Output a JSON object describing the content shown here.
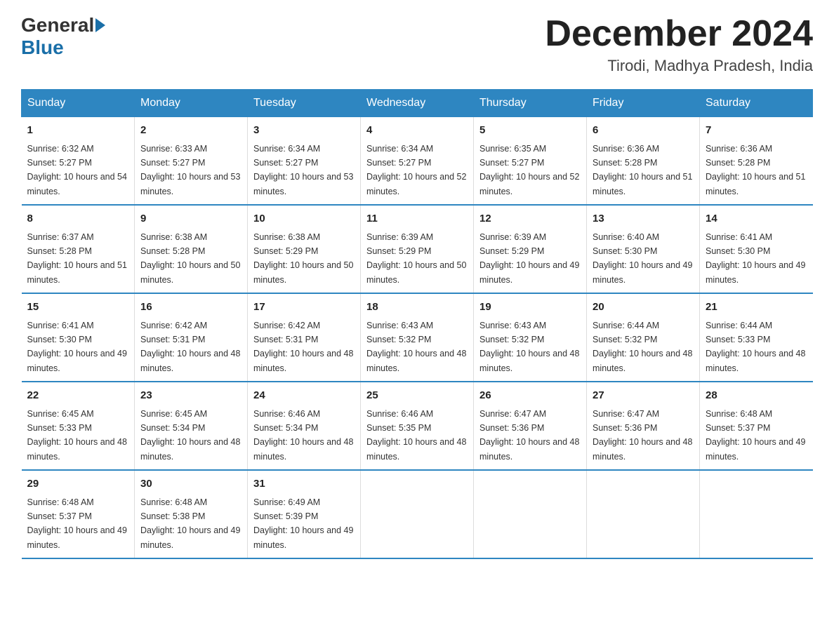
{
  "header": {
    "logo_general": "General",
    "logo_blue": "Blue",
    "month_title": "December 2024",
    "location": "Tirodi, Madhya Pradesh, India"
  },
  "days_of_week": [
    "Sunday",
    "Monday",
    "Tuesday",
    "Wednesday",
    "Thursday",
    "Friday",
    "Saturday"
  ],
  "weeks": [
    [
      {
        "day": "1",
        "sunrise": "6:32 AM",
        "sunset": "5:27 PM",
        "daylight": "10 hours and 54 minutes."
      },
      {
        "day": "2",
        "sunrise": "6:33 AM",
        "sunset": "5:27 PM",
        "daylight": "10 hours and 53 minutes."
      },
      {
        "day": "3",
        "sunrise": "6:34 AM",
        "sunset": "5:27 PM",
        "daylight": "10 hours and 53 minutes."
      },
      {
        "day": "4",
        "sunrise": "6:34 AM",
        "sunset": "5:27 PM",
        "daylight": "10 hours and 52 minutes."
      },
      {
        "day": "5",
        "sunrise": "6:35 AM",
        "sunset": "5:27 PM",
        "daylight": "10 hours and 52 minutes."
      },
      {
        "day": "6",
        "sunrise": "6:36 AM",
        "sunset": "5:28 PM",
        "daylight": "10 hours and 51 minutes."
      },
      {
        "day": "7",
        "sunrise": "6:36 AM",
        "sunset": "5:28 PM",
        "daylight": "10 hours and 51 minutes."
      }
    ],
    [
      {
        "day": "8",
        "sunrise": "6:37 AM",
        "sunset": "5:28 PM",
        "daylight": "10 hours and 51 minutes."
      },
      {
        "day": "9",
        "sunrise": "6:38 AM",
        "sunset": "5:28 PM",
        "daylight": "10 hours and 50 minutes."
      },
      {
        "day": "10",
        "sunrise": "6:38 AM",
        "sunset": "5:29 PM",
        "daylight": "10 hours and 50 minutes."
      },
      {
        "day": "11",
        "sunrise": "6:39 AM",
        "sunset": "5:29 PM",
        "daylight": "10 hours and 50 minutes."
      },
      {
        "day": "12",
        "sunrise": "6:39 AM",
        "sunset": "5:29 PM",
        "daylight": "10 hours and 49 minutes."
      },
      {
        "day": "13",
        "sunrise": "6:40 AM",
        "sunset": "5:30 PM",
        "daylight": "10 hours and 49 minutes."
      },
      {
        "day": "14",
        "sunrise": "6:41 AM",
        "sunset": "5:30 PM",
        "daylight": "10 hours and 49 minutes."
      }
    ],
    [
      {
        "day": "15",
        "sunrise": "6:41 AM",
        "sunset": "5:30 PM",
        "daylight": "10 hours and 49 minutes."
      },
      {
        "day": "16",
        "sunrise": "6:42 AM",
        "sunset": "5:31 PM",
        "daylight": "10 hours and 48 minutes."
      },
      {
        "day": "17",
        "sunrise": "6:42 AM",
        "sunset": "5:31 PM",
        "daylight": "10 hours and 48 minutes."
      },
      {
        "day": "18",
        "sunrise": "6:43 AM",
        "sunset": "5:32 PM",
        "daylight": "10 hours and 48 minutes."
      },
      {
        "day": "19",
        "sunrise": "6:43 AM",
        "sunset": "5:32 PM",
        "daylight": "10 hours and 48 minutes."
      },
      {
        "day": "20",
        "sunrise": "6:44 AM",
        "sunset": "5:32 PM",
        "daylight": "10 hours and 48 minutes."
      },
      {
        "day": "21",
        "sunrise": "6:44 AM",
        "sunset": "5:33 PM",
        "daylight": "10 hours and 48 minutes."
      }
    ],
    [
      {
        "day": "22",
        "sunrise": "6:45 AM",
        "sunset": "5:33 PM",
        "daylight": "10 hours and 48 minutes."
      },
      {
        "day": "23",
        "sunrise": "6:45 AM",
        "sunset": "5:34 PM",
        "daylight": "10 hours and 48 minutes."
      },
      {
        "day": "24",
        "sunrise": "6:46 AM",
        "sunset": "5:34 PM",
        "daylight": "10 hours and 48 minutes."
      },
      {
        "day": "25",
        "sunrise": "6:46 AM",
        "sunset": "5:35 PM",
        "daylight": "10 hours and 48 minutes."
      },
      {
        "day": "26",
        "sunrise": "6:47 AM",
        "sunset": "5:36 PM",
        "daylight": "10 hours and 48 minutes."
      },
      {
        "day": "27",
        "sunrise": "6:47 AM",
        "sunset": "5:36 PM",
        "daylight": "10 hours and 48 minutes."
      },
      {
        "day": "28",
        "sunrise": "6:48 AM",
        "sunset": "5:37 PM",
        "daylight": "10 hours and 49 minutes."
      }
    ],
    [
      {
        "day": "29",
        "sunrise": "6:48 AM",
        "sunset": "5:37 PM",
        "daylight": "10 hours and 49 minutes."
      },
      {
        "day": "30",
        "sunrise": "6:48 AM",
        "sunset": "5:38 PM",
        "daylight": "10 hours and 49 minutes."
      },
      {
        "day": "31",
        "sunrise": "6:49 AM",
        "sunset": "5:39 PM",
        "daylight": "10 hours and 49 minutes."
      },
      null,
      null,
      null,
      null
    ]
  ]
}
